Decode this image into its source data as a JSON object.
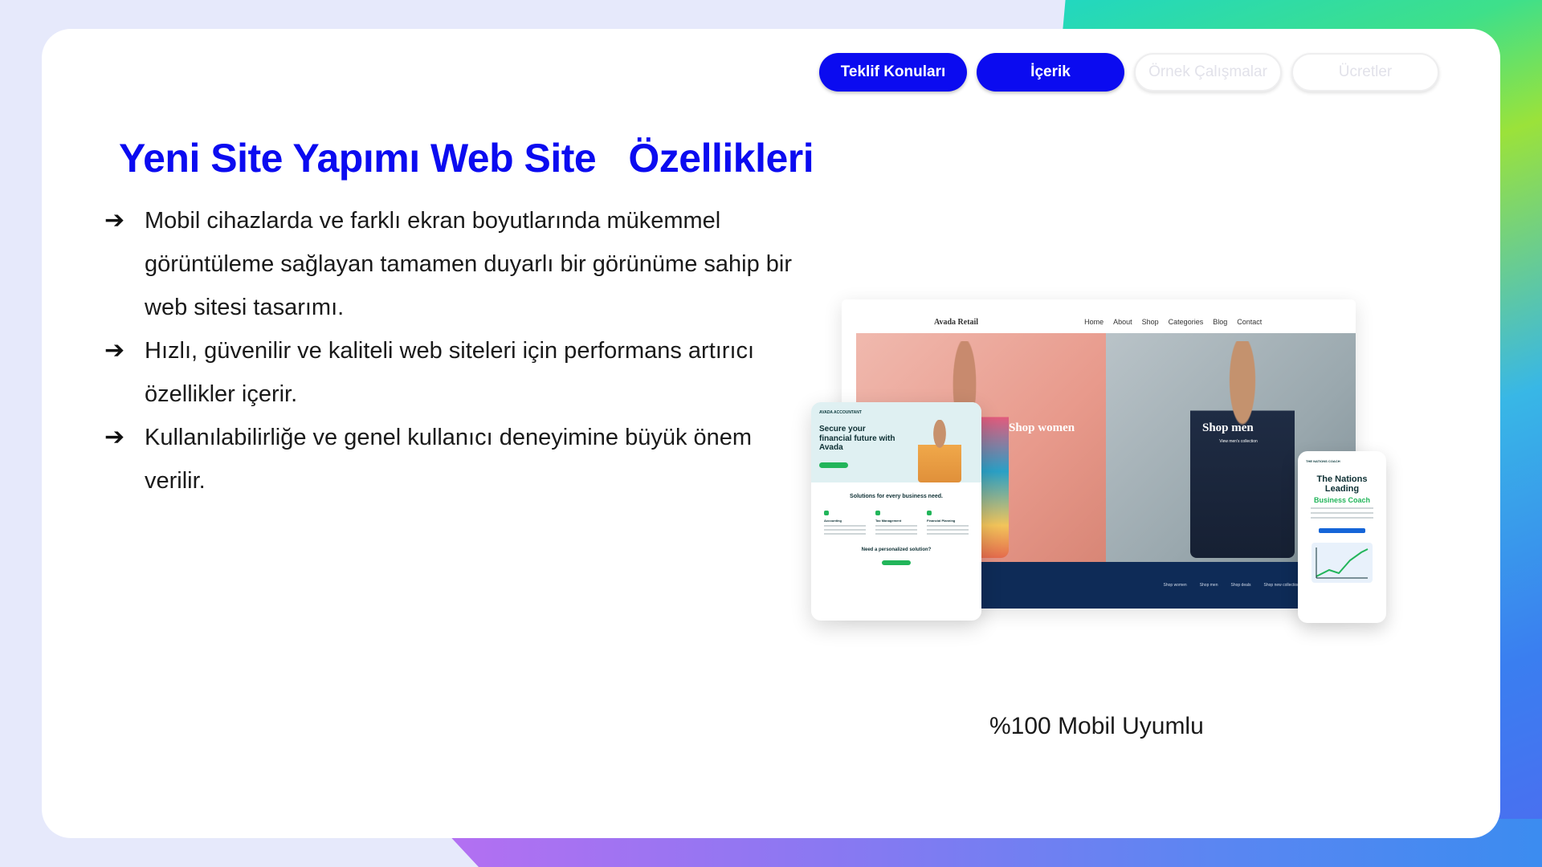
{
  "nav": {
    "items": [
      {
        "label": "Teklif Konuları",
        "state": "active"
      },
      {
        "label": "İçerik",
        "state": "active"
      },
      {
        "label": "Örnek Çalışmalar",
        "state": "inactive"
      },
      {
        "label": "Ücretler",
        "state": "inactive"
      }
    ]
  },
  "main": {
    "title": "Yeni Site Yapımı Web Site   Özellikleri",
    "bullets": [
      "Mobil cihazlarda ve farklı ekran boyutlarında mükemmel görüntüleme sağlayan tamamen duyarlı bir görünüme sahip bir web sitesi tasarımı.",
      "Hızlı, güvenilir ve kaliteli web siteleri için performans artırıcı özellikler içerir.",
      "Kullanılabilirliğe ve genel kullanıcı deneyimine büyük önem verilir."
    ],
    "caption": "%100 Mobil Uyumlu"
  },
  "mockup": {
    "desktop": {
      "brand": "Avada Retail",
      "nav": [
        "Home",
        "About",
        "Shop",
        "Categories",
        "Blog",
        "Contact"
      ],
      "hero_left_label": "Shop women",
      "hero_right_label": "Shop men",
      "hero_right_link": "View men's collection",
      "footer_links": [
        "Shop women",
        "Shop men",
        "Shop deals",
        "Shop new collection"
      ]
    },
    "tablet": {
      "logo": "AVADA ACCOUNTANT",
      "headline": "Secure your financial future with Avada",
      "section_title": "Solutions for every business need.",
      "columns": [
        "Accounting",
        "Tax Management",
        "Financial Planning"
      ],
      "need_title": "Need a personalized solution?"
    },
    "phone": {
      "logo": "THE NATIONS COACH",
      "title": "The Nations Leading",
      "accent": "Business Coach"
    }
  },
  "colors": {
    "brand_blue": "#0b0bf0",
    "card": "#ffffff",
    "background": "#e6e9fb"
  },
  "icons": {
    "bullet": "arrow-right-icon"
  }
}
